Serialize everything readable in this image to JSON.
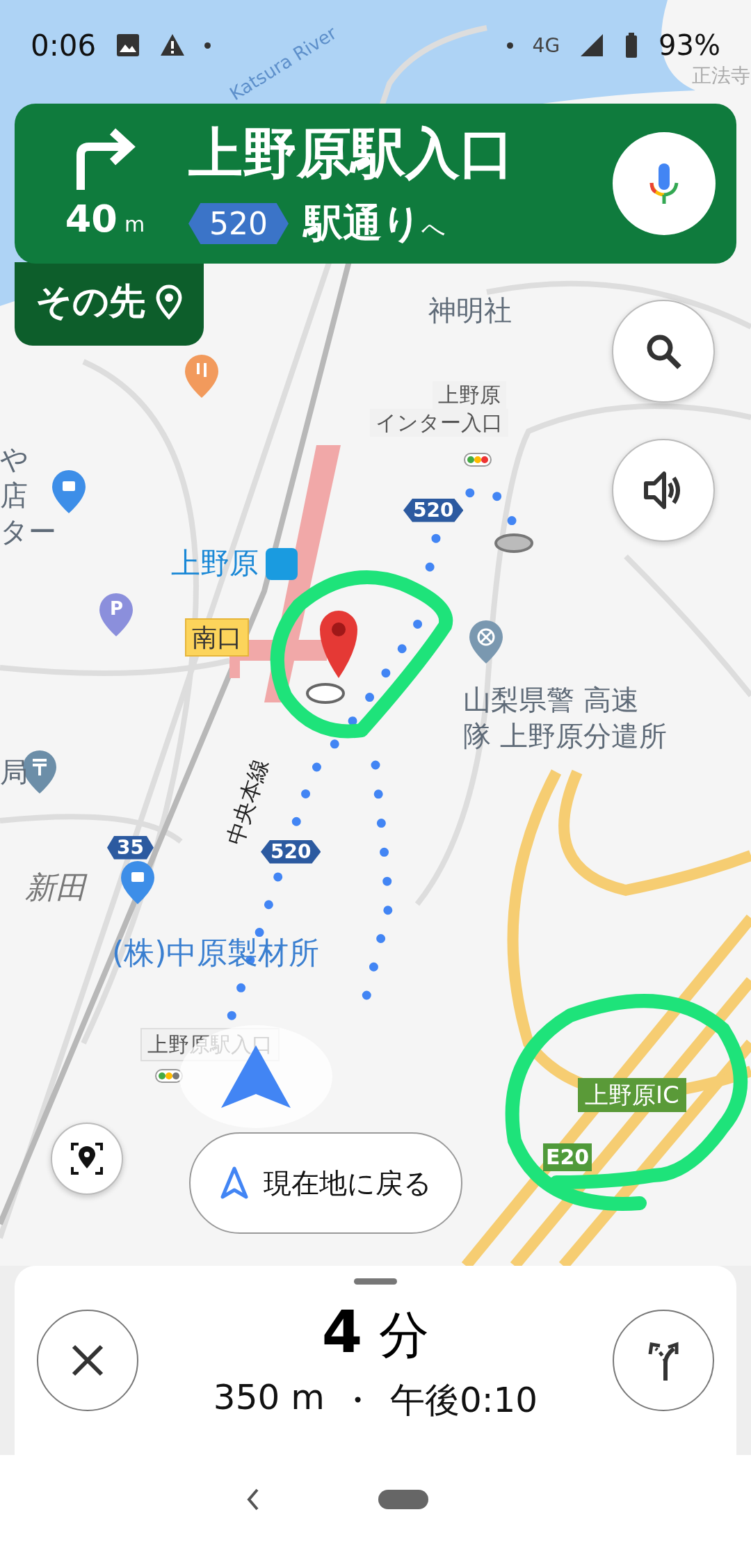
{
  "status_bar": {
    "time": "0:06",
    "network": "4G",
    "battery": "93%"
  },
  "instruction": {
    "distance": "40",
    "unit": "m",
    "street": "上野原駅入口",
    "route_number": "520",
    "toward": "駅通り",
    "particle": "へ"
  },
  "then": {
    "label": "その先"
  },
  "map": {
    "labels": [
      {
        "text": "Katsura River",
        "kind": "water"
      },
      {
        "text": "正法寺",
        "kind": "faint"
      },
      {
        "text": "神明社",
        "kind": "place"
      },
      {
        "text": "上野原",
        "kind": "sign"
      },
      {
        "text": "インター入口",
        "kind": "sign"
      },
      {
        "text": "や",
        "kind": "place"
      },
      {
        "text": "店",
        "kind": "place"
      },
      {
        "text": "ター",
        "kind": "place"
      },
      {
        "text": "上野原",
        "kind": "station"
      },
      {
        "text": "南口",
        "kind": "exit"
      },
      {
        "text": "山梨県警 高速",
        "kind": "place"
      },
      {
        "text": "隊 上野原分遣所",
        "kind": "place"
      },
      {
        "text": "中央本線",
        "kind": "rail"
      },
      {
        "text": "局",
        "kind": "place"
      },
      {
        "text": "新田",
        "kind": "area"
      },
      {
        "text": "(株)中原製材所",
        "kind": "business"
      },
      {
        "text": "上野原駅入口",
        "kind": "gate"
      },
      {
        "text": "上野原IC",
        "kind": "interchange"
      },
      {
        "text": "E20",
        "kind": "expressway"
      },
      {
        "text": "35",
        "kind": "shield"
      },
      {
        "text": "520",
        "kind": "shield"
      },
      {
        "text": "520",
        "kind": "shield"
      },
      {
        "text": "P",
        "kind": "parking"
      }
    ]
  },
  "recenter": {
    "label": "現在地に戻る"
  },
  "trip": {
    "duration": "4",
    "duration_unit": "分",
    "distance": "350 m",
    "separator": "・",
    "arrival": "午後0:10"
  }
}
